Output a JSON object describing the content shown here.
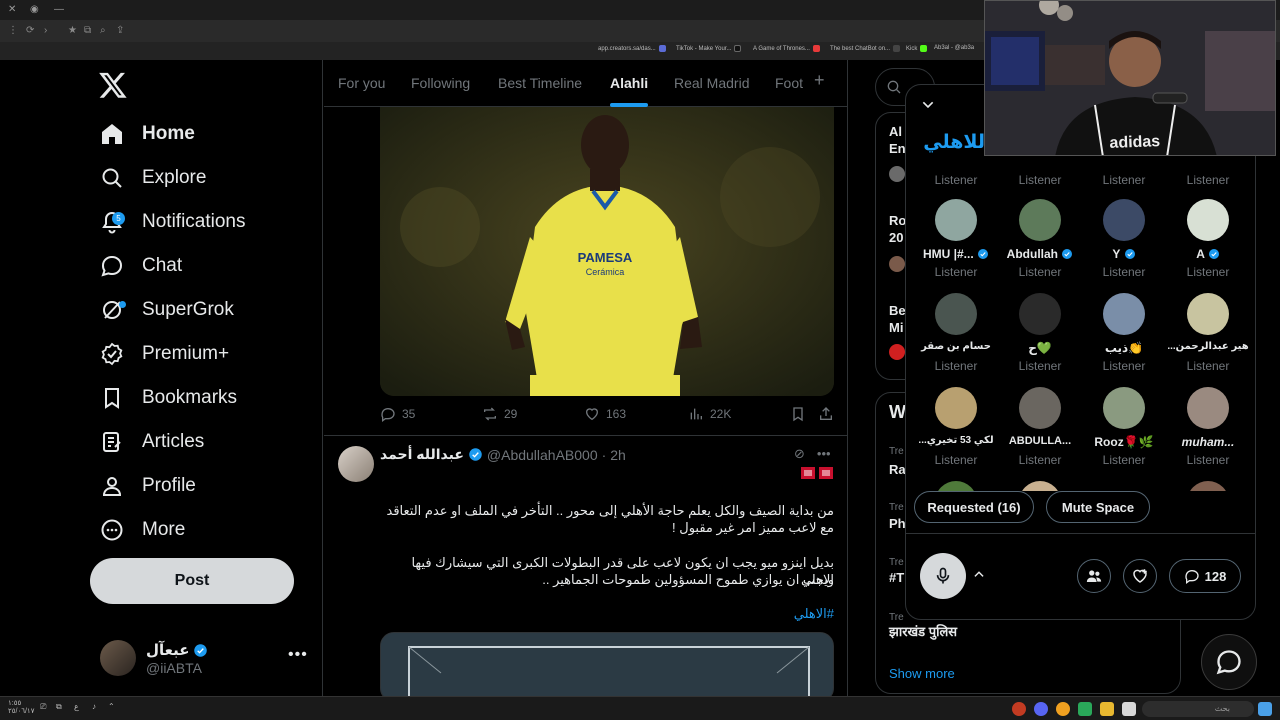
{
  "browser": {
    "bookmarks": [
      {
        "label": "app.creators.sa/das...",
        "color": "#5b6bd6"
      },
      {
        "label": "TikTok - Make Your...",
        "color": "#111111"
      },
      {
        "label": "A Game of Thrones...",
        "color": "#e83a3a"
      },
      {
        "label": "The best ChatBot on...",
        "color": "#444444"
      },
      {
        "label": "Kick",
        "color": "#53fc18"
      },
      {
        "label": "Ab3al - @ab3a",
        "color": "#1d9bf0"
      }
    ]
  },
  "sidebar": {
    "items": [
      {
        "label": "Home",
        "icon": "home-icon"
      },
      {
        "label": "Explore",
        "icon": "search-icon"
      },
      {
        "label": "Notifications",
        "icon": "bell-icon",
        "badge": "5"
      },
      {
        "label": "Chat",
        "icon": "chat-icon"
      },
      {
        "label": "SuperGrok",
        "icon": "grok-icon"
      },
      {
        "label": "Premium+",
        "icon": "premium-icon"
      },
      {
        "label": "Bookmarks",
        "icon": "bookmark-icon"
      },
      {
        "label": "Articles",
        "icon": "articles-icon"
      },
      {
        "label": "Profile",
        "icon": "profile-icon"
      },
      {
        "label": "More",
        "icon": "more-icon"
      }
    ],
    "post_label": "Post",
    "account": {
      "name": "عبعآل",
      "handle": "@iiABTA"
    }
  },
  "feed": {
    "tabs": [
      "For you",
      "Following",
      "Best Timeline",
      "Alahli",
      "Real Madrid",
      "Foot"
    ],
    "active_tab": "Alahli",
    "first_post_stats": {
      "replies": "35",
      "reposts": "29",
      "likes": "163",
      "views": "22K"
    },
    "tweet": {
      "name": "عبدالله أحمد",
      "handle": "@AbdullahAB000",
      "time": "· 2h",
      "para1_line1": "من بداية الصيف والكل يعلم حاجة الأهلي إلى محور .. التأخر في الملف او عدم التعاقد",
      "para1_line2": "مع لاعب مميز امر غير مقبول !",
      "para2_line1": "بديل اينزو ميو يجب ان يكون لاعب على قدر البطولات الكبرى التي سيشارك فيها الاهلي",
      "para2_line2": "ويجب ان يوازي طموح المسؤولين طموحات الجماهير ..",
      "hashtag": "#الاهلي"
    }
  },
  "right": {
    "snippets": [
      "Al",
      "En",
      "Ro",
      "20",
      "Be",
      "Mi",
      "W",
      "Tre",
      "Ra",
      "Tre",
      "Ph",
      "Tre",
      "#T",
      "Tre"
    ],
    "last_trend": "झारखंड पुलिस",
    "show_more": "Show more"
  },
  "space": {
    "title": "للاهلي",
    "listener_label": "Listener",
    "participants": [
      {
        "name": "HMU |#...",
        "verified": true,
        "color": "#8fa6a0"
      },
      {
        "name": "Abdullah",
        "verified": true,
        "color": "#5d7a5a"
      },
      {
        "name": "Y",
        "verified": true,
        "color": "#3c4a66"
      },
      {
        "name": "A",
        "verified": true,
        "color": "#d8e0d4"
      },
      {
        "name": "حسام بن صقر",
        "verified": false,
        "color": "#4a5550"
      },
      {
        "name": "ح💚",
        "verified": false,
        "color": "#2a2a2a"
      },
      {
        "name": "ذيب👏",
        "verified": false,
        "color": "#7a8ea8"
      },
      {
        "name": "...هير عبدالرحمن",
        "verified": false,
        "color": "#c8c4a0"
      },
      {
        "name": "...لكي 53 تخيري",
        "verified": false,
        "color": "#b8a070"
      },
      {
        "name": "ABDULLA...",
        "verified": false,
        "color": "#6a6660"
      },
      {
        "name": "Rooz🌹🌿",
        "verified": false,
        "color": "#8a9a80"
      },
      {
        "name": "muham...",
        "verified": false,
        "color": "#9a8a80"
      }
    ],
    "requested_label": "Requested (16)",
    "mute_label": "Mute Space",
    "replies_count": "128"
  },
  "taskbar": {
    "time": "١:٥٥",
    "date": "٢٥/٠٦/١٧",
    "search_placeholder": "بحث"
  },
  "colors": {
    "accent": "#1d9bf0",
    "background": "#000000",
    "border": "#2f3336",
    "muted": "#71767b"
  }
}
